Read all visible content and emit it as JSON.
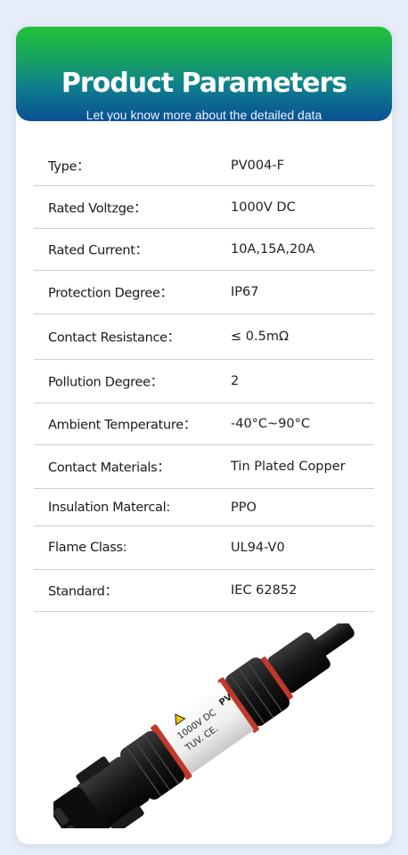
{
  "header": {
    "title": "Product Parameters",
    "subtitle": "Let you know more about the detailed data"
  },
  "specs": [
    {
      "label": "Type：",
      "value": "PV004-F"
    },
    {
      "label": "Rated Voltzge：",
      "value": "1000V DC"
    },
    {
      "label": "Rated Current：",
      "value": "10A,15A,20A"
    },
    {
      "label": "Protection Degree：",
      "value": "IP67"
    },
    {
      "label": "Contact Resistance：",
      "value": "≤ 0.5mΩ"
    },
    {
      "label": "Pollution Degree：",
      "value": "2"
    },
    {
      "label": "Ambient Temperature：",
      "value": "-40°C~90°C"
    },
    {
      "label": "Contact Materials：",
      "value": "Tin Plated Copper"
    },
    {
      "label": "Insulation Matercal:",
      "value": "PPO"
    },
    {
      "label": "Flame Class:",
      "value": "UL94-V0"
    },
    {
      "label": "Standard：",
      "value": "IEC 62852"
    }
  ],
  "product_image": {
    "label_line1": "1000V DC",
    "label_line2": "TUV. CE.",
    "label_side": "PV"
  }
}
